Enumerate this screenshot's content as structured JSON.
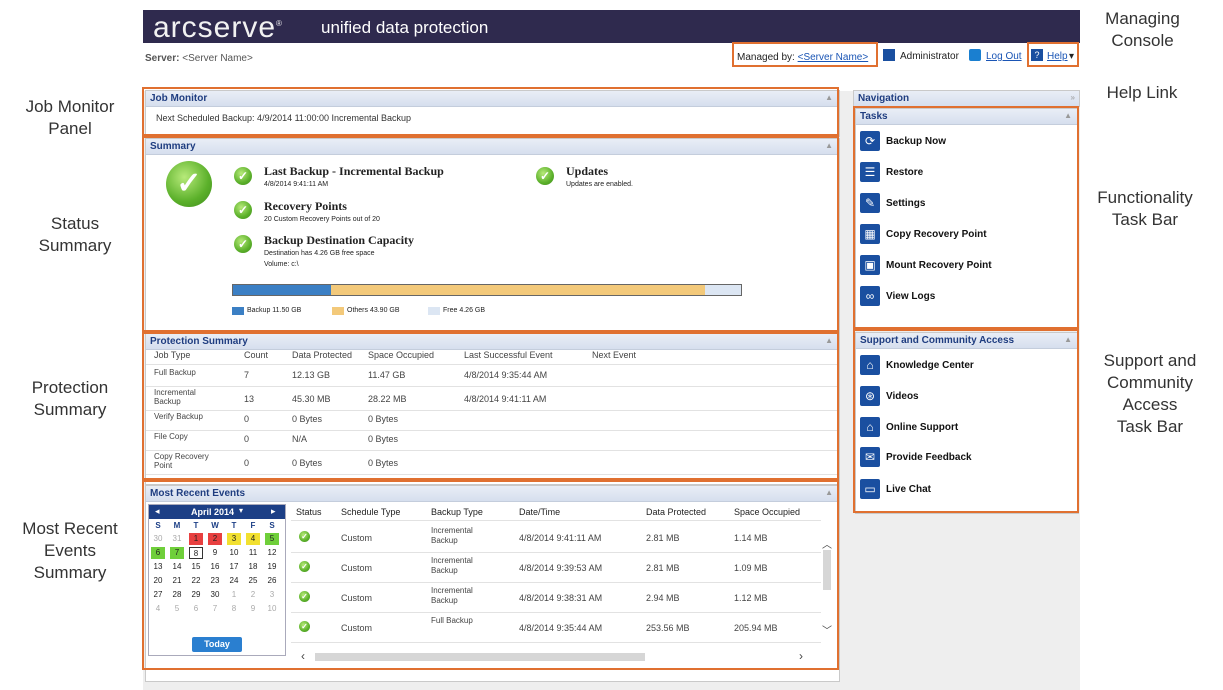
{
  "annotations": {
    "managing_console": "Managing\nConsole",
    "help_link": "Help Link",
    "job_monitor_panel": "Job Monitor\nPanel",
    "status_summary": "Status\nSummary",
    "functionality_task_bar": "Functionality\nTask Bar",
    "protection_summary": "Protection\nSummary",
    "support_task_bar": "Support and\nCommunity\nAccess\nTask Bar",
    "most_recent_events": "Most Recent\nEvents\nSummary"
  },
  "header": {
    "logo": "arcserve",
    "product": "unified data protection",
    "server_label": "Server:",
    "server_name": "<Server Name>",
    "managed_by_label": "Managed by:",
    "managed_by_value": "<Server Name>",
    "user": "Administrator",
    "logout": "Log Out",
    "help": "Help"
  },
  "job_monitor": {
    "title": "Job Monitor",
    "next_backup": "Next Scheduled Backup: 4/9/2014  11:00:00 Incremental Backup"
  },
  "summary": {
    "title": "Summary",
    "last_backup_title": "Last Backup - Incremental Backup",
    "last_backup_date": "4/8/2014 9:41:11 AM",
    "recovery_title": "Recovery Points",
    "recovery_detail": "20 Custom Recovery Points out of 20",
    "capacity_title": "Backup Destination Capacity",
    "capacity_detail": "Destination has 4.26 GB free space",
    "volume": "Volume: c:\\",
    "updates_title": "Updates",
    "updates_detail": "Updates are enabled.",
    "legend_backup": "Backup 11.50 GB",
    "legend_others": "Others 43.90 GB",
    "legend_free": "Free 4.26 GB",
    "usage": {
      "backup": 11.5,
      "others": 43.9,
      "free": 4.26
    }
  },
  "protection": {
    "title": "Protection Summary",
    "headers": [
      "Job Type",
      "Count",
      "Data Protected",
      "Space Occupied",
      "Last Successful Event",
      "Next Event"
    ],
    "rows": [
      [
        "Full Backup",
        "7",
        "12.13 GB",
        "11.47 GB",
        "4/8/2014 9:35:44 AM",
        ""
      ],
      [
        "Incremental Backup",
        "13",
        "45.30 MB",
        "28.22 MB",
        "4/8/2014 9:41:11 AM",
        ""
      ],
      [
        "Verify Backup",
        "0",
        "0 Bytes",
        "0 Bytes",
        "",
        ""
      ],
      [
        "File Copy",
        "0",
        "N/A",
        "0 Bytes",
        "",
        ""
      ],
      [
        "Copy Recovery Point",
        "0",
        "0 Bytes",
        "0 Bytes",
        "",
        ""
      ]
    ]
  },
  "events": {
    "title": "Most Recent Events",
    "calendar_month": "April 2014",
    "weekdays": [
      "S",
      "M",
      "T",
      "W",
      "T",
      "F",
      "S"
    ],
    "weeks": [
      [
        "30",
        "31",
        "1",
        "2",
        "3",
        "4",
        "5"
      ],
      [
        "6",
        "7",
        "8",
        "9",
        "10",
        "11",
        "12"
      ],
      [
        "13",
        "14",
        "15",
        "16",
        "17",
        "18",
        "19"
      ],
      [
        "20",
        "21",
        "22",
        "23",
        "24",
        "25",
        "26"
      ],
      [
        "27",
        "28",
        "29",
        "30",
        "1",
        "2",
        "3"
      ],
      [
        "4",
        "5",
        "6",
        "7",
        "8",
        "9",
        "10"
      ]
    ],
    "today": "Today",
    "headers": [
      "Status",
      "Schedule Type",
      "Backup Type",
      "Date/Time",
      "Data Protected",
      "Space Occupied"
    ],
    "rows": [
      [
        "Custom",
        "Incremental Backup",
        "4/8/2014 9:41:11 AM",
        "2.81 MB",
        "1.14 MB"
      ],
      [
        "Custom",
        "Incremental Backup",
        "4/8/2014 9:39:53 AM",
        "2.81 MB",
        "1.09 MB"
      ],
      [
        "Custom",
        "Incremental Backup",
        "4/8/2014 9:38:31 AM",
        "2.94 MB",
        "1.12 MB"
      ],
      [
        "Custom",
        "Full Backup",
        "4/8/2014 9:35:44 AM",
        "253.56 MB",
        "205.94 MB"
      ]
    ]
  },
  "navigation": {
    "title": "Navigation",
    "tasks_title": "Tasks",
    "tasks": [
      "Backup Now",
      "Restore",
      "Settings",
      "Copy Recovery Point",
      "Mount Recovery Point",
      "View Logs"
    ],
    "support_title": "Support and Community Access",
    "support": [
      "Knowledge Center",
      "Videos",
      "Online Support",
      "Provide Feedback",
      "Live Chat"
    ]
  },
  "colors": {
    "accent_orange": "#e07030",
    "banner": "#2f2a4e",
    "link": "#1a55b5",
    "backup_bar": "#3b7fc4",
    "others_bar": "#f3c97a",
    "free_bar": "#dce6f3"
  }
}
